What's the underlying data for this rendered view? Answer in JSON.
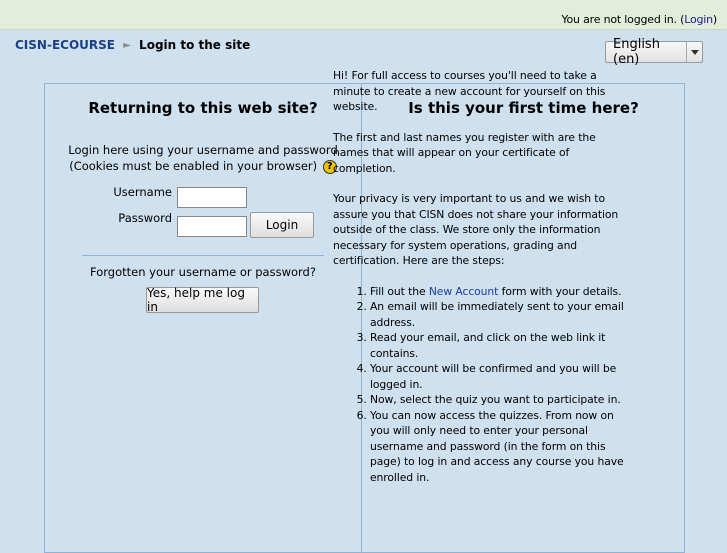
{
  "header": {
    "login_status_prefix": "You are not logged in. (",
    "login_link": "Login",
    "login_status_suffix": ")"
  },
  "navbar": {
    "site": "CISN-ECOURSE",
    "separator": "►",
    "current": "Login to the site"
  },
  "language": {
    "selected": "English (en)"
  },
  "returning": {
    "heading": "Returning to this web site?",
    "intro_line1": "Login here using your username and password",
    "intro_line2": "(Cookies must be enabled in your browser)",
    "help_icon": "?",
    "username_label": "Username",
    "password_label": "Password",
    "username_value": "",
    "password_value": "",
    "login_button": "Login",
    "forgot_text": "Forgotten your username or password?",
    "help_button": "Yes, help me log in"
  },
  "first_time": {
    "heading": "Is this your first time here?",
    "para1": "Hi! For full access to courses you'll need to take a minute to create a new account for yourself on this website.",
    "para2": "The first and last names you register with are the names that will appear on your certificate of completion.",
    "para3": "Your privacy is very important to us and we wish to assure you that CISN does not share your information outside of the class. We store only the information necessary for system operations, grading and certification. Here are the steps:",
    "step1_prefix": "Fill out the ",
    "step1_link": "New Account",
    "step1_suffix": " form with your details.",
    "steps": [
      "An email will be immediately sent to your email address.",
      "Read your email, and click on the web link it contains.",
      "Your account will be confirmed and you will be logged in.",
      "Now, select the quiz you want to participate in.",
      "You can now access the quizzes. From now on you will only need to enter your personal username and password (in the form on this page) to log in and access any course you have enrolled in."
    ]
  },
  "colors": {
    "page_background": "#cfe0ef",
    "header_background": "#e2eedb",
    "border": "#8fb3d3",
    "link": "#1a3fa0"
  }
}
